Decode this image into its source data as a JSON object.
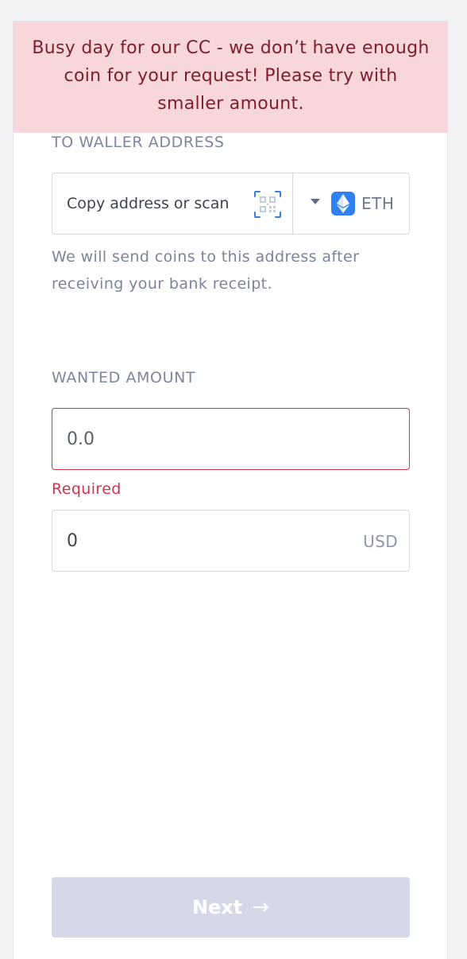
{
  "alert": {
    "message": "Busy day for our CC - we don’t have enough coin for your request! Please try with smaller amount."
  },
  "wallet": {
    "label": "TO WALLER ADDRESS",
    "address_placeholder": "Copy address or scan",
    "qr_icon": "qr-code-icon",
    "currency": "ETH",
    "currency_icon": "ethereum-icon",
    "help_text": "We will send coins to this address after receiving your bank receipt."
  },
  "amount": {
    "label": "WANTED AMOUNT",
    "placeholder": "0.0",
    "value": "",
    "error": "Required",
    "usd_value": "0",
    "usd_suffix": "USD"
  },
  "actions": {
    "next_label": "Next",
    "next_arrow": "→"
  },
  "colors": {
    "alert_bg": "#f8d7da",
    "alert_text": "#7c1f2c",
    "error": "#d1314a",
    "eth_blue": "#2f80f6",
    "button_disabled": "#d5d8e8"
  }
}
